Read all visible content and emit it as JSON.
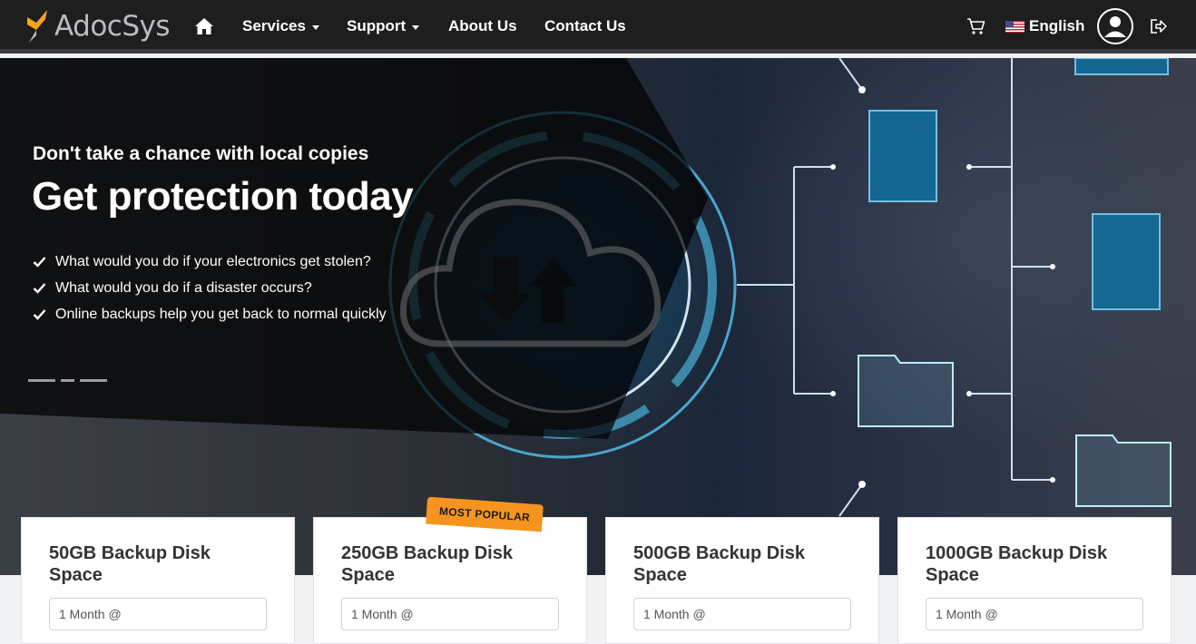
{
  "brand": {
    "name": "AdocSys",
    "accent": "#f7a41d"
  },
  "nav": {
    "items": [
      {
        "label": "Services",
        "dropdown": true
      },
      {
        "label": "Support",
        "dropdown": true
      },
      {
        "label": "About Us",
        "dropdown": false
      },
      {
        "label": "Contact Us",
        "dropdown": false
      }
    ],
    "language": "English",
    "icons": [
      "home-icon",
      "cart-icon",
      "us-flag-icon",
      "user-icon",
      "logout-icon"
    ]
  },
  "hero": {
    "subtitle": "Don't take a chance with local copies",
    "title": "Get protection today",
    "bullets": [
      "What would you do if your electronics get stolen?",
      "What would you do if a disaster occurs?",
      "Online backups help you get back to normal quickly"
    ],
    "slides": 3,
    "active_slide": 1
  },
  "plans": [
    {
      "title": "50GB Backup Disk Space",
      "period_placeholder": "1 Month @"
    },
    {
      "title": "250GB Backup Disk Space",
      "period_placeholder": "1 Month @",
      "badge": "MOST POPULAR"
    },
    {
      "title": "500GB Backup Disk Space",
      "period_placeholder": "1 Month @"
    },
    {
      "title": "1000GB Backup Disk Space",
      "period_placeholder": "1 Month @"
    }
  ]
}
